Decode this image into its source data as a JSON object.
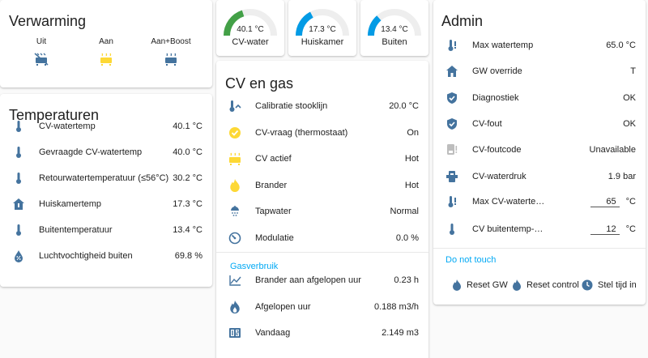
{
  "colors": {
    "icon": "#44739e",
    "accent": "#03a9f4",
    "active": "#fdd835",
    "gauge_green": "#43a047",
    "gauge_blue": "#039be5"
  },
  "verwarming": {
    "title": "Verwarming",
    "modes": [
      {
        "label": "Uit",
        "icon": "radiator-off-icon"
      },
      {
        "label": "Aan",
        "icon": "radiator-icon"
      },
      {
        "label": "Aan+Boost",
        "icon": "radiator-boost-icon"
      }
    ]
  },
  "temperaturen": {
    "title": "Temperaturen",
    "rows": [
      {
        "name": "CV-watertemp",
        "value": "40.1 °C",
        "icon": "thermometer-icon"
      },
      {
        "name": "Gevraagde CV-watertemp",
        "value": "40.0 °C",
        "icon": "thermometer-icon"
      },
      {
        "name": "Retourwatertemperatuur (≤56°C)",
        "value": "30.2 °C",
        "icon": "thermometer-icon"
      },
      {
        "name": "Huiskamertemp",
        "value": "17.3 °C",
        "icon": "home-thermometer-icon"
      },
      {
        "name": "Buitentemperatuur",
        "value": "13.4 °C",
        "icon": "thermometer-icon"
      },
      {
        "name": "Luchtvochtigheid buiten",
        "value": "69.8 %",
        "icon": "water-percent-icon"
      }
    ]
  },
  "gauges": [
    {
      "value": "40.1 °C",
      "name": "CV-water",
      "level": 0.4
    },
    {
      "value": "17.3 °C",
      "name": "Huiskamer",
      "level": 0.35
    },
    {
      "value": "13.4 °C",
      "name": "Buiten",
      "level": 0.27
    }
  ],
  "cvgas": {
    "title": "CV en gas",
    "rows": [
      {
        "name": "Calibratie stooklijn",
        "value": "20.0 °C",
        "icon": "thermometer-chevron-icon"
      },
      {
        "name": "CV-vraag (thermostaat)",
        "value": "On",
        "icon": "check-circle-icon"
      },
      {
        "name": "CV actief",
        "value": "Hot",
        "icon": "radiator-icon"
      },
      {
        "name": "Brander",
        "value": "Hot",
        "icon": "fire-icon"
      },
      {
        "name": "Tapwater",
        "value": "Normal",
        "icon": "shower-icon"
      },
      {
        "name": "Modulatie",
        "value": "0.0 %",
        "icon": "gauge-icon"
      }
    ],
    "section": "Gasverbruik",
    "gas_rows": [
      {
        "name": "Brander aan afgelopen uur",
        "value": "0.23 h",
        "icon": "chart-line-icon"
      },
      {
        "name": "Afgelopen uur",
        "value": "0.188 m3/h",
        "icon": "gas-flame-icon"
      },
      {
        "name": "Vandaag",
        "value": "2.149 m3",
        "icon": "counter-icon"
      }
    ]
  },
  "admin": {
    "title": "Admin",
    "rows": [
      {
        "name": "Max watertemp",
        "value": "65.0 °C",
        "icon": "thermometer-alert-icon"
      },
      {
        "name": "GW override",
        "value": "T",
        "icon": "home-icon"
      },
      {
        "name": "Diagnostiek",
        "value": "OK",
        "icon": "shield-check-icon"
      },
      {
        "name": "CV-fout",
        "value": "OK",
        "icon": "shield-check-icon"
      },
      {
        "name": "CV-foutcode",
        "value": "Unavailable",
        "icon": "water-boiler-alert-icon"
      },
      {
        "name": "CV-waterdruk",
        "value": "1.9 bar",
        "icon": "water-pump-icon"
      }
    ],
    "inputs": [
      {
        "name": "Max CV-waterte…",
        "value": "65",
        "unit": "°C",
        "icon": "thermometer-alert-icon"
      },
      {
        "name": "CV buitentemp-…",
        "value": "12",
        "unit": "°C",
        "icon": "thermometer-icon"
      }
    ],
    "section": "Do not touch",
    "actions": [
      {
        "label": "Reset GW",
        "icon": "fire-icon"
      },
      {
        "label": "Reset control",
        "icon": "fire-icon"
      },
      {
        "label": "Stel tijd in",
        "icon": "clock-icon"
      }
    ]
  }
}
